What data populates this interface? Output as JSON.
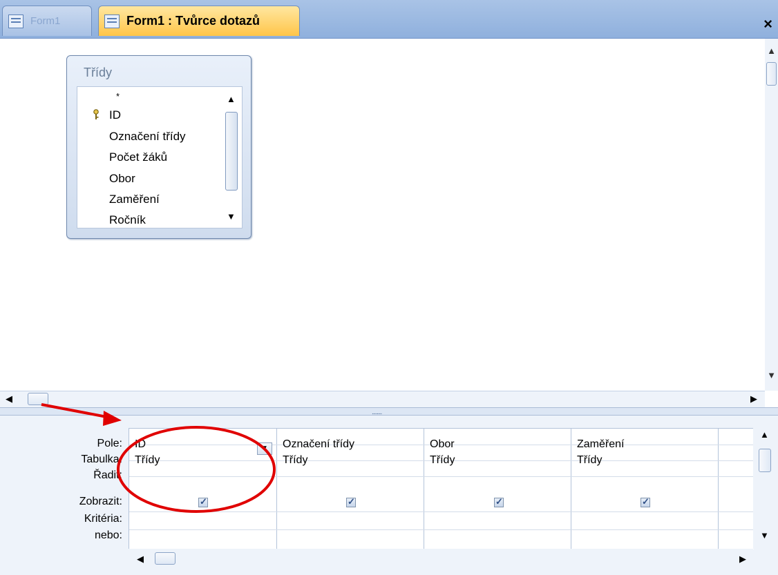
{
  "tabs": [
    {
      "label": "Form1",
      "active": false
    },
    {
      "label": "Form1 : Tvůrce dotazů",
      "active": true
    }
  ],
  "close_glyph": "×",
  "table_box": {
    "title": "Třídy",
    "fields": [
      "*",
      "ID",
      "Označení třídy",
      "Počet žáků",
      "Obor",
      "Zaměření",
      "Ročník"
    ],
    "primary_key_field": "ID"
  },
  "grid": {
    "row_labels": [
      "Pole:",
      "Tabulka:",
      "Řadit:",
      "Zobrazit:",
      "Kritéria:",
      "nebo:"
    ],
    "columns": [
      {
        "field": "ID",
        "table": "Třídy",
        "show": true
      },
      {
        "field": "Označení třídy",
        "table": "Třídy",
        "show": true
      },
      {
        "field": "Obor",
        "table": "Třídy",
        "show": true
      },
      {
        "field": "Zaměření",
        "table": "Třídy",
        "show": true
      }
    ]
  },
  "splitter_grip": "........",
  "colors": {
    "tab_active": "#ffc54a",
    "annotation": "#e00000"
  }
}
